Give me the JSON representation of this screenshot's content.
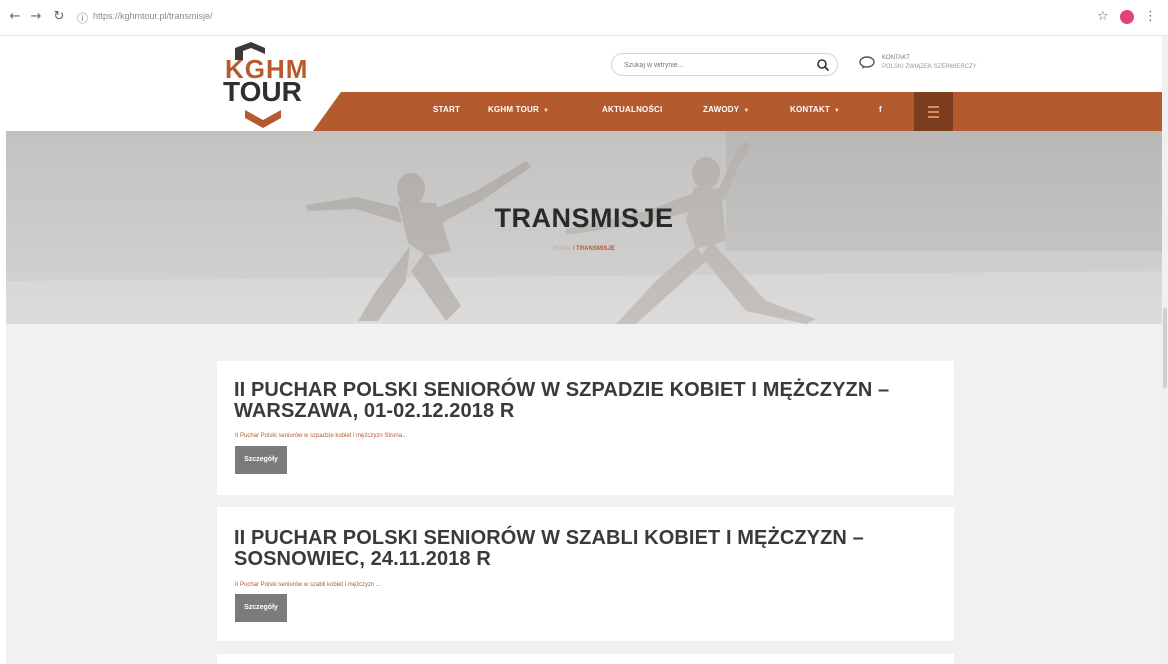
{
  "browser": {
    "url": "https://kghmtour.pl/transmisje/"
  },
  "header": {
    "logo_top": "KGHM",
    "logo_bottom": "TOUR",
    "search_placeholder": "Szukaj w witrynie...",
    "contact_label": "KONTAKT",
    "contact_sub": "POLSKI ZWIĄZEK SZERMIERCZY"
  },
  "nav": {
    "items": [
      {
        "label": "START",
        "caret": false
      },
      {
        "label": "KGHM TOUR",
        "caret": true
      },
      {
        "label": "AKTUALNOŚCI",
        "caret": false
      },
      {
        "label": "ZAWODY",
        "caret": true
      },
      {
        "label": "KONTAKT",
        "caret": true
      },
      {
        "label": "f",
        "caret": false
      }
    ]
  },
  "hero": {
    "title": "TRANSMISJE",
    "breadcrumb_home": "HOME",
    "breadcrumb_sep": " / ",
    "breadcrumb_current": "TRANSMISJE"
  },
  "posts": [
    {
      "title": "II PUCHAR POLSKI SENIORÓW W SZPADZIE KOBIET I MĘŻCZYZN – WARSZAWA, 01-02.12.2018 R",
      "excerpt": "II Puchar Polski seniorów w szpadzie kobiet i mężczyzn Strona...",
      "button": "Szczegóły"
    },
    {
      "title": "II PUCHAR POLSKI SENIORÓW W SZABLI KOBIET I MĘŻCZYZN – SOSNOWIEC, 24.11.2018 R",
      "excerpt": "II Puchar Polski seniorów w szabli kobiet i mężczyzn ...",
      "button": "Szczegóły"
    }
  ],
  "colors": {
    "accent": "#b35b2e",
    "accent_dark": "#7c3e1f",
    "button": "#7b7b7b",
    "title_text": "#3a3a3a"
  }
}
